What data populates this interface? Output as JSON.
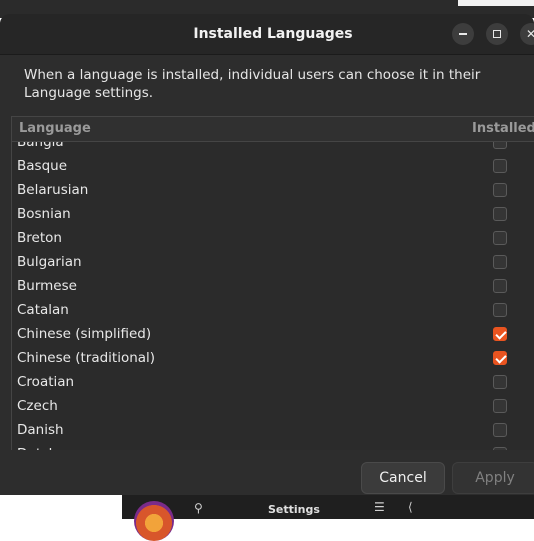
{
  "dialog": {
    "title": "Installed Languages",
    "description": "When a language is installed, individual users can choose it in their Language settings."
  },
  "list": {
    "header_language": "Language",
    "header_installed": "Installed",
    "items": [
      {
        "label": "Bangla",
        "installed": false
      },
      {
        "label": "Basque",
        "installed": false
      },
      {
        "label": "Belarusian",
        "installed": false
      },
      {
        "label": "Bosnian",
        "installed": false
      },
      {
        "label": "Breton",
        "installed": false
      },
      {
        "label": "Bulgarian",
        "installed": false
      },
      {
        "label": "Burmese",
        "installed": false
      },
      {
        "label": "Catalan",
        "installed": false
      },
      {
        "label": "Chinese (simplified)",
        "installed": true
      },
      {
        "label": "Chinese (traditional)",
        "installed": true
      },
      {
        "label": "Croatian",
        "installed": false
      },
      {
        "label": "Czech",
        "installed": false
      },
      {
        "label": "Danish",
        "installed": false
      },
      {
        "label": "Dutch",
        "installed": false
      }
    ]
  },
  "footer": {
    "cancel_label": "Cancel",
    "apply_label": "Apply"
  },
  "background_window": {
    "title": "Settings"
  },
  "colors": {
    "accent": "#e95420"
  }
}
